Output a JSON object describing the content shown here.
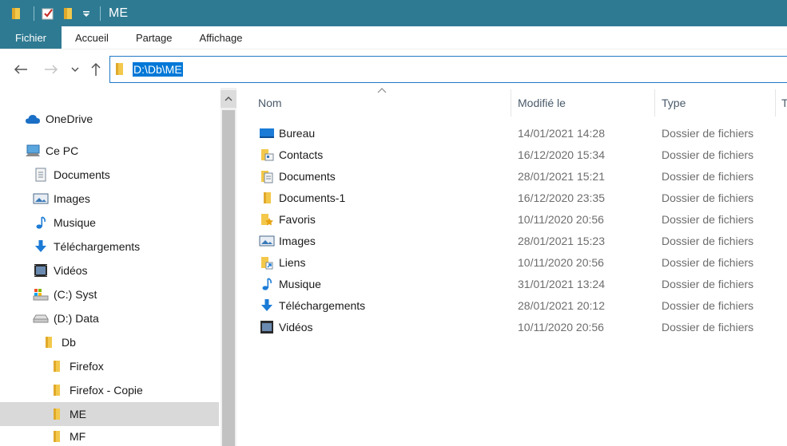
{
  "window": {
    "title": "ME"
  },
  "ribbon": {
    "tabs": [
      "Fichier",
      "Accueil",
      "Partage",
      "Affichage"
    ]
  },
  "address": {
    "path": "D:\\Db\\ME"
  },
  "nav": {
    "items": [
      {
        "label": "OneDrive",
        "icon": "onedrive-icon"
      },
      {
        "label": "Ce PC",
        "icon": "computer-icon"
      },
      {
        "label": "Documents",
        "icon": "documents-icon"
      },
      {
        "label": "Images",
        "icon": "images-icon"
      },
      {
        "label": "Musique",
        "icon": "music-icon"
      },
      {
        "label": "Téléchargements",
        "icon": "download-icon"
      },
      {
        "label": "Vidéos",
        "icon": "video-icon"
      },
      {
        "label": "(C:) Syst",
        "icon": "drive-c-icon"
      },
      {
        "label": "(D:) Data",
        "icon": "drive-d-icon"
      },
      {
        "label": "Db",
        "icon": "folder-icon"
      },
      {
        "label": "Firefox",
        "icon": "folder-icon"
      },
      {
        "label": "Firefox - Copie",
        "icon": "folder-icon"
      },
      {
        "label": "ME",
        "icon": "folder-icon",
        "selected": true
      },
      {
        "label": "MF",
        "icon": "folder-icon"
      }
    ]
  },
  "columns": {
    "name": "Nom",
    "modified": "Modifié le",
    "type": "Type",
    "size": "T"
  },
  "files": [
    {
      "name": "Bureau",
      "date": "14/01/2021 14:28",
      "type": "Dossier de fichiers",
      "icon": "desktop-icon"
    },
    {
      "name": "Contacts",
      "date": "16/12/2020 15:34",
      "type": "Dossier de fichiers",
      "icon": "contacts-icon"
    },
    {
      "name": "Documents",
      "date": "28/01/2021 15:21",
      "type": "Dossier de fichiers",
      "icon": "documents-icon"
    },
    {
      "name": "Documents-1",
      "date": "16/12/2020 23:35",
      "type": "Dossier de fichiers",
      "icon": "folder-icon"
    },
    {
      "name": "Favoris",
      "date": "10/11/2020 20:56",
      "type": "Dossier de fichiers",
      "icon": "favorites-icon"
    },
    {
      "name": "Images",
      "date": "28/01/2021 15:23",
      "type": "Dossier de fichiers",
      "icon": "images-icon"
    },
    {
      "name": "Liens",
      "date": "10/11/2020 20:56",
      "type": "Dossier de fichiers",
      "icon": "links-icon"
    },
    {
      "name": "Musique",
      "date": "31/01/2021 13:24",
      "type": "Dossier de fichiers",
      "icon": "music-icon"
    },
    {
      "name": "Téléchargements",
      "date": "28/01/2021 20:12",
      "type": "Dossier de fichiers",
      "icon": "download-icon"
    },
    {
      "name": "Vidéos",
      "date": "10/11/2020 20:56",
      "type": "Dossier de fichiers",
      "icon": "video-icon"
    }
  ],
  "colors": {
    "titlebar": "#2e7a92",
    "selection": "#0078d7",
    "nav_selected": "#d9d9d9"
  }
}
